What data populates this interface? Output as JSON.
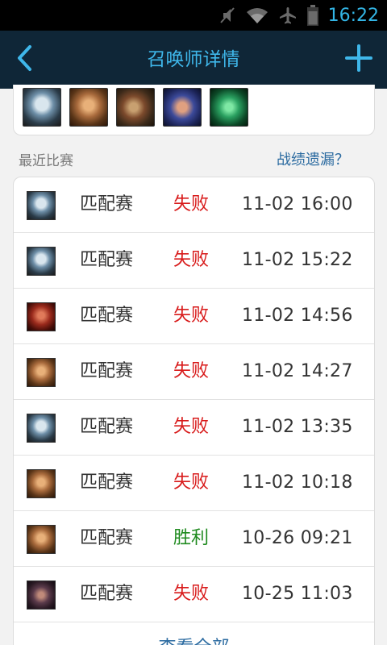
{
  "status_bar": {
    "time": "16:22",
    "icons": [
      "mute-icon",
      "wifi-icon",
      "airplane-icon",
      "battery-icon"
    ]
  },
  "header": {
    "title": "召唤师详情",
    "back_icon": "chevron-left-icon",
    "add_icon": "plus-icon"
  },
  "recent_heroes": [
    {
      "portrait": "hero-annie"
    },
    {
      "portrait": "hero-garen"
    },
    {
      "portrait": "hero-jinx"
    },
    {
      "portrait": "hero-jarvan"
    },
    {
      "portrait": "hero-thresh"
    }
  ],
  "section": {
    "label": "最近比赛",
    "missing_link": "战绩遗漏？"
  },
  "matches": [
    {
      "mode": "匹配赛",
      "result": "失败",
      "time": "11-02 16:00",
      "portrait": "hero-annie"
    },
    {
      "mode": "匹配赛",
      "result": "失败",
      "time": "11-02 15:22",
      "portrait": "hero-annie"
    },
    {
      "mode": "匹配赛",
      "result": "失败",
      "time": "11-02 14:56",
      "portrait": "hero-red"
    },
    {
      "mode": "匹配赛",
      "result": "失败",
      "time": "11-02 14:27",
      "portrait": "hero-garen"
    },
    {
      "mode": "匹配赛",
      "result": "失败",
      "time": "11-02 13:35",
      "portrait": "hero-annie"
    },
    {
      "mode": "匹配赛",
      "result": "失败",
      "time": "11-02 10:18",
      "portrait": "hero-garen"
    },
    {
      "mode": "匹配赛",
      "result": "胜利",
      "time": "10-26 09:21",
      "portrait": "hero-garen"
    },
    {
      "mode": "匹配赛",
      "result": "失败",
      "time": "10-25 11:03",
      "portrait": "hero-dark"
    }
  ],
  "view_all": "查看全部",
  "colors": {
    "nav_bg": "#0f2637",
    "accent": "#3fb7ea",
    "loss": "#d81a1a",
    "win": "#1e8a1e",
    "link": "#2a6aa0"
  }
}
